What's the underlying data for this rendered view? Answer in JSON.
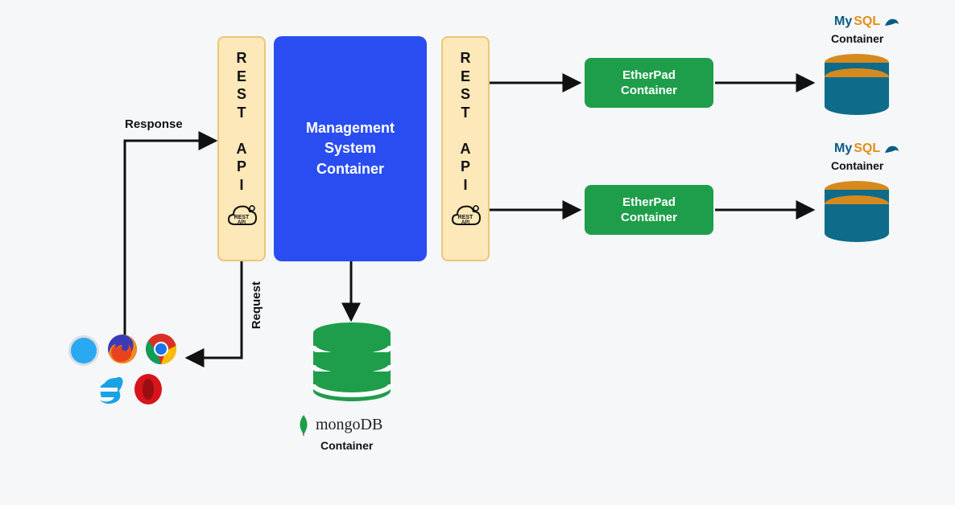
{
  "left_api": {
    "letters": "R\nE\nS\nT\n\nA\nP\nI",
    "icon_label": "rest-api-icon"
  },
  "right_api": {
    "letters": "R\nE\nS\nT\n\nA\nP\nI",
    "icon_label": "rest-api-icon"
  },
  "management": {
    "title": "Management\nSystem\nContainer"
  },
  "etherpad": {
    "top": "EtherPad\nContainer",
    "bottom": "EtherPad\nContainer"
  },
  "mysql_instances": [
    {
      "brand_my": "My",
      "brand_sql": "SQL",
      "label": "Container"
    },
    {
      "brand_my": "My",
      "brand_sql": "SQL",
      "label": "Container"
    }
  ],
  "mongo": {
    "brand": "mongoDB",
    "label": "Container"
  },
  "arrows": {
    "response_label": "Response",
    "request_label": "Request"
  },
  "browsers": {
    "icons": [
      "safari-icon",
      "firefox-icon",
      "chrome-icon",
      "ie-icon",
      "opera-icon"
    ]
  },
  "colors": {
    "management_bg": "#2a4df2",
    "etherpad_bg": "#1e9e4a",
    "api_bg": "#fce8b9",
    "api_border": "#e8c97a",
    "db_green": "#1e9e4a",
    "db_teal": "#0e6b8a",
    "db_orange": "#d68a1e",
    "mysql_my": "#0a5b84",
    "mysql_sql": "#e48e1a"
  }
}
